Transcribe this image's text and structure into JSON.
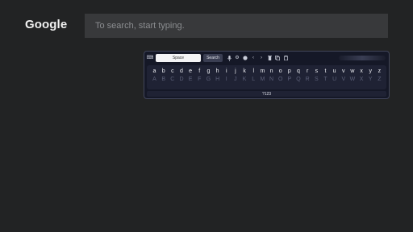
{
  "header": {
    "logo_text": "Google"
  },
  "search": {
    "placeholder": "To search, start typing."
  },
  "keyboard": {
    "space_label": "Space",
    "search_label": "Search",
    "lowercase": [
      "a",
      "b",
      "c",
      "d",
      "e",
      "f",
      "g",
      "h",
      "i",
      "j",
      "k",
      "l",
      "m",
      "n",
      "o",
      "p",
      "q",
      "r",
      "s",
      "t",
      "u",
      "v",
      "w",
      "x",
      "y",
      "z"
    ],
    "uppercase": [
      "A",
      "B",
      "C",
      "D",
      "E",
      "F",
      "G",
      "H",
      "I",
      "J",
      "K",
      "L",
      "M",
      "N",
      "O",
      "P",
      "Q",
      "R",
      "S",
      "T",
      "U",
      "V",
      "W",
      "X",
      "Y",
      "Z"
    ],
    "symbols_label": "?123",
    "toolbar_icons": [
      "keyboard-icon",
      "mic-icon",
      "gear-icon",
      "globe-icon",
      "chevron-left-icon",
      "chevron-right-icon",
      "delete-icon",
      "copy-icon",
      "paste-icon"
    ]
  },
  "colors": {
    "background": "#222324",
    "search_bar": "#38393b",
    "keyboard_bg": "#151827",
    "space_key": "#f4f4f6"
  }
}
